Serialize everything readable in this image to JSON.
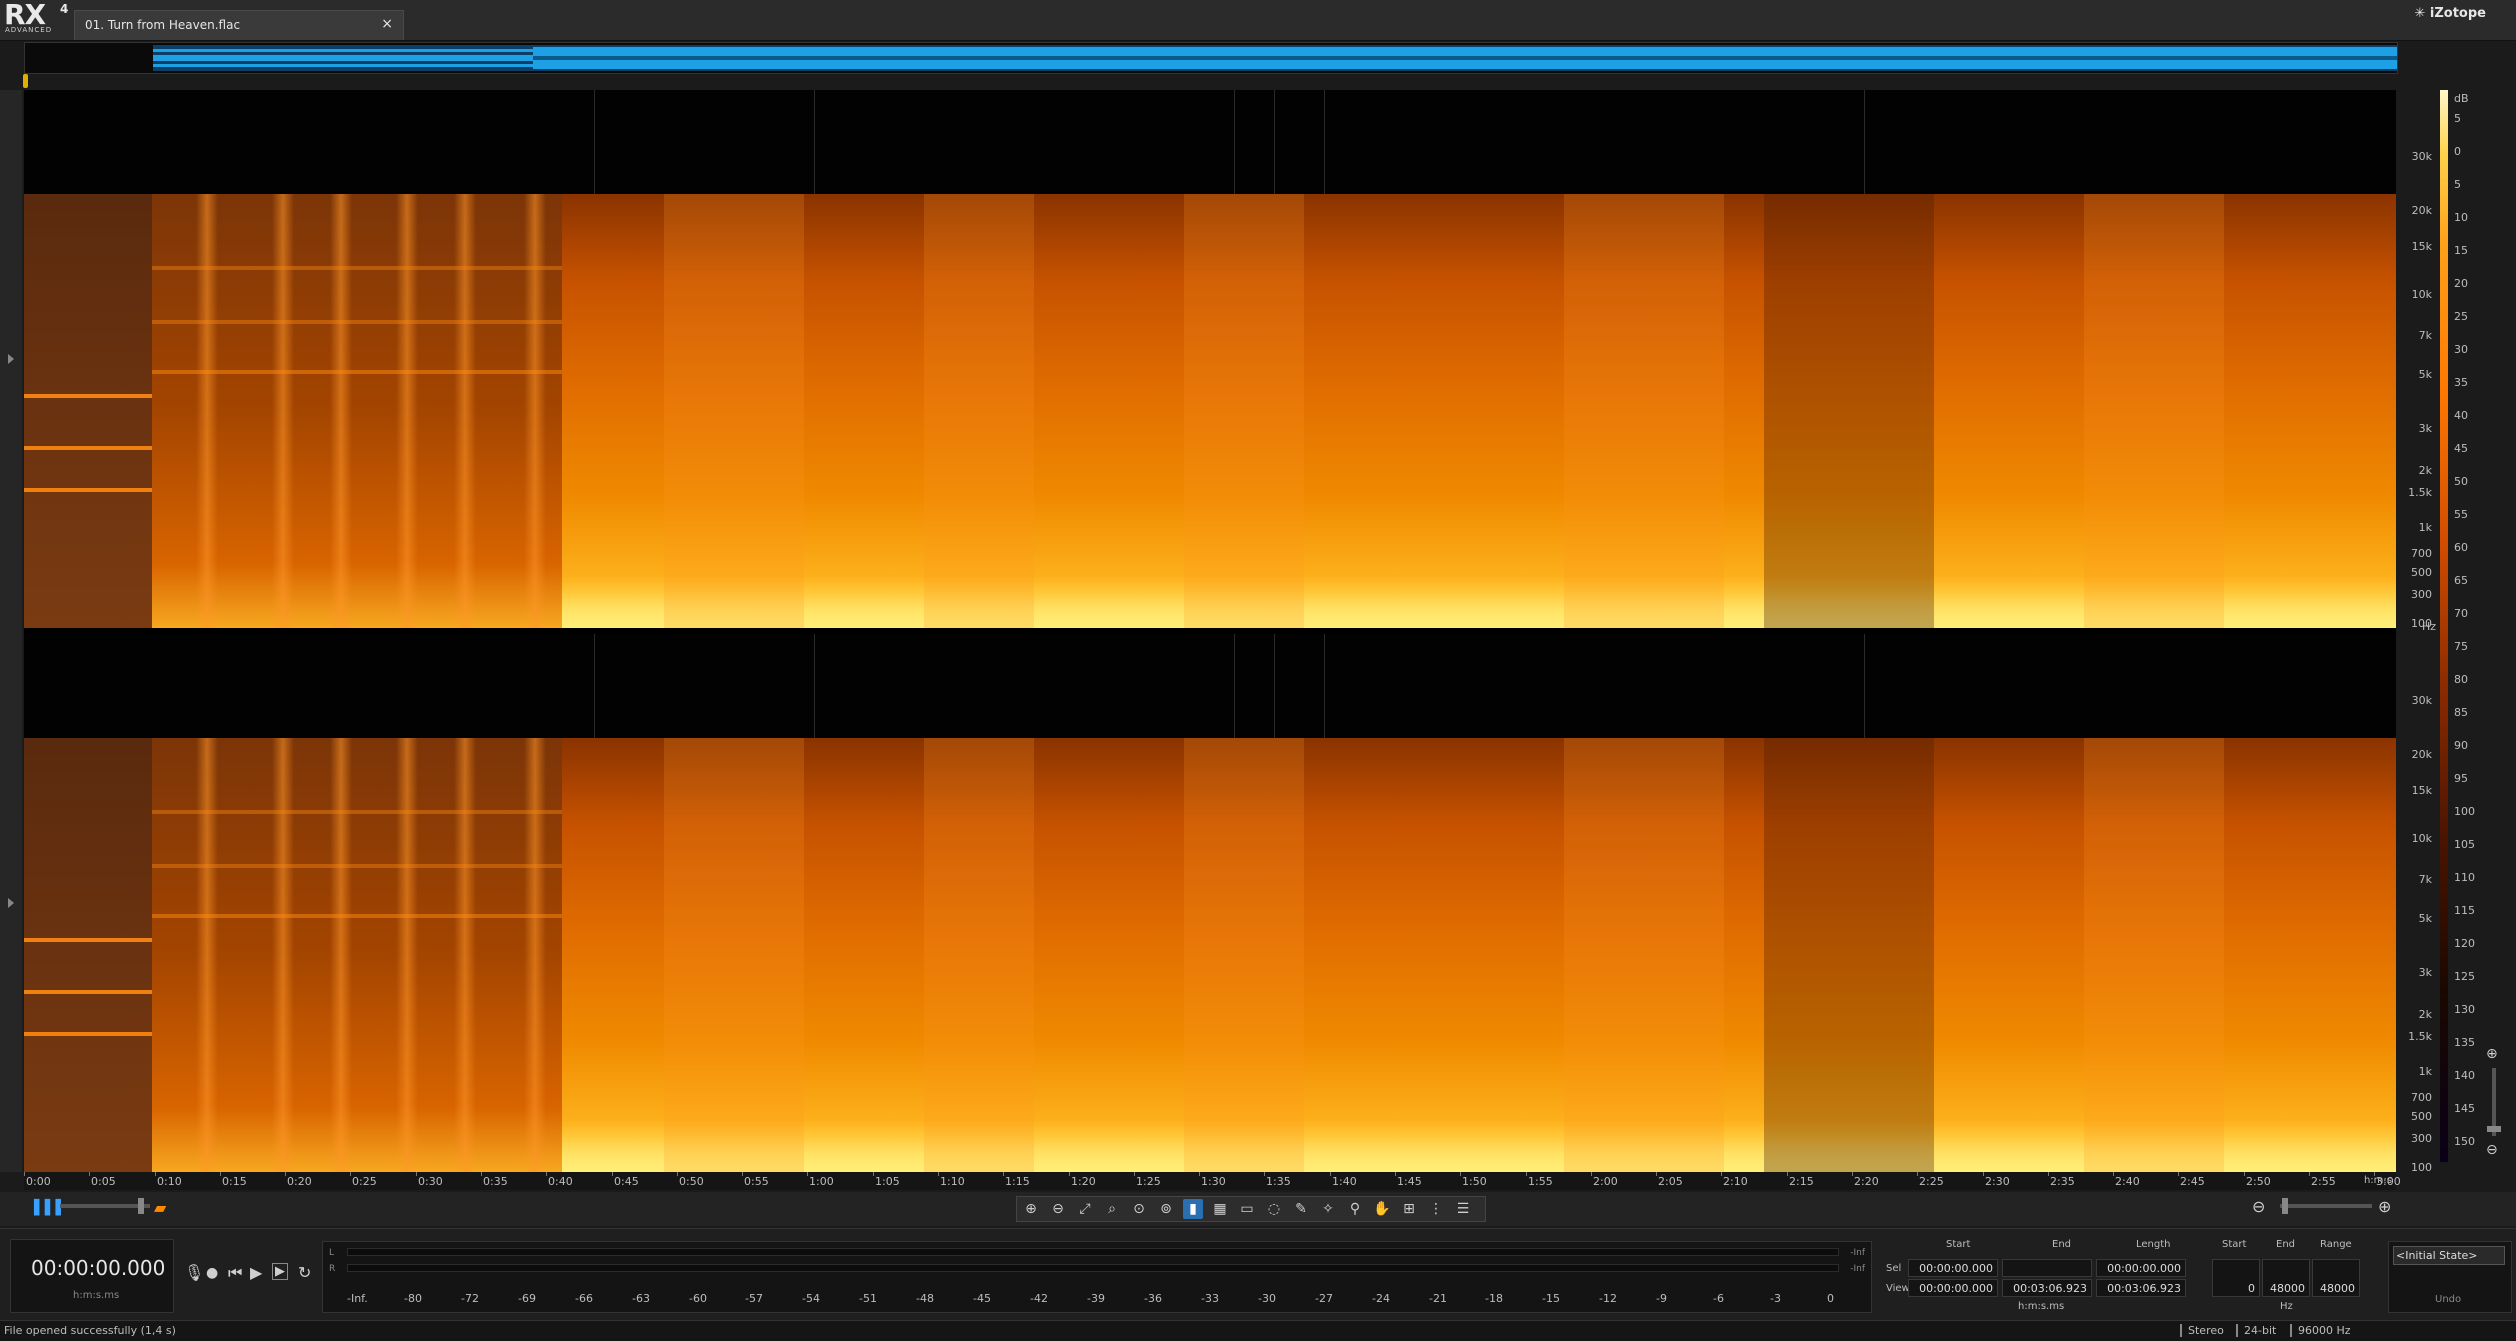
{
  "app": {
    "logo_text": "RX",
    "logo_version": "4",
    "logo_edition": "ADVANCED",
    "brand": "iZotope"
  },
  "tab": {
    "title": "01. Turn from Heaven.flac",
    "close_label": "×"
  },
  "colors": {
    "waveform": "#1ea0e6",
    "spectrogram_low": "#ffe070",
    "spectrogram_high": "#8a3300",
    "accent": "#2a6fb2"
  },
  "frequency_axis": {
    "labels": [
      "30k",
      "20k",
      "15k",
      "10k",
      "7k",
      "5k",
      "3k",
      "2k",
      "1.5k",
      "1k",
      "700",
      "500",
      "300",
      "100"
    ],
    "unit": "Hz"
  },
  "db_axis": {
    "unit": "dB",
    "labels": [
      "5",
      "0",
      "5",
      "10",
      "15",
      "20",
      "25",
      "30",
      "35",
      "40",
      "45",
      "50",
      "55",
      "60",
      "65",
      "70",
      "75",
      "80",
      "85",
      "90",
      "95",
      "100",
      "105",
      "110",
      "115",
      "120",
      "125",
      "130",
      "135",
      "140",
      "145",
      "150"
    ]
  },
  "time_axis": {
    "labels": [
      "0:00",
      "0:05",
      "0:10",
      "0:15",
      "0:20",
      "0:25",
      "0:30",
      "0:35",
      "0:40",
      "0:45",
      "0:50",
      "0:55",
      "1:00",
      "1:05",
      "1:10",
      "1:15",
      "1:20",
      "1:25",
      "1:30",
      "1:35",
      "1:40",
      "1:45",
      "1:50",
      "1:55",
      "2:00",
      "2:05",
      "2:10",
      "2:15",
      "2:20",
      "2:25",
      "2:30",
      "2:35",
      "2:40",
      "2:45",
      "2:50",
      "2:55",
      "3:00"
    ],
    "unit": "h:m:s"
  },
  "toolbar": {
    "tools": [
      "zoom-in-icon",
      "zoom-out-icon",
      "zoom-fit-icon",
      "zoom-selection-icon",
      "zoom-time-icon",
      "zoom-freq-icon",
      "time-select-icon",
      "time-freq-select-icon",
      "freq-select-icon",
      "lasso-icon",
      "brush-icon",
      "magic-wand-icon",
      "magnify-icon",
      "hand-icon",
      "snap-icon",
      "harmonics-icon",
      "settings-icon"
    ],
    "active_tool": "time-select-icon"
  },
  "transport": {
    "time": "00:00:00.000",
    "time_unit": "h:m:s.ms"
  },
  "meter": {
    "left_label": "L",
    "right_label": "R",
    "inf_left": "-Inf.",
    "inf_right": "-Inf",
    "scale": [
      "-Inf.",
      "-80",
      "-72",
      "-69",
      "-66",
      "-63",
      "-60",
      "-57",
      "-54",
      "-51",
      "-48",
      "-45",
      "-42",
      "-39",
      "-36",
      "-33",
      "-30",
      "-27",
      "-24",
      "-21",
      "-18",
      "-15",
      "-12",
      "-9",
      "-6",
      "-3",
      "0"
    ]
  },
  "selection": {
    "headers": [
      "Start",
      "End",
      "Length"
    ],
    "sel_label": "Sel",
    "view_label": "View",
    "sel": [
      "00:00:00.000",
      "",
      ""
    ],
    "view": [
      "00:00:00.000",
      "00:03:06.923",
      "00:03:06.923"
    ],
    "sel_length": "00:00:00.000",
    "unit": "h:m:s.ms"
  },
  "frequency_range": {
    "headers": [
      "Start",
      "End",
      "Range"
    ],
    "values": [
      "0",
      "48000",
      "48000"
    ],
    "unit": "Hz"
  },
  "undo": {
    "item": "<Initial State>",
    "label": "Undo"
  },
  "status": {
    "message": "File opened successfully (1,4 s)",
    "channels": "Stereo",
    "bit_depth": "24-bit",
    "sample_rate": "96000 Hz"
  }
}
